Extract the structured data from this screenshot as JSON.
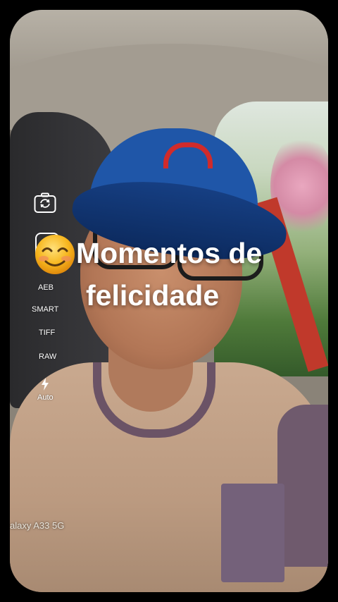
{
  "overlay_text": {
    "line1": "Momentos de",
    "line2": "felicidade"
  },
  "camera_controls": {
    "switch_camera_icon": "camera-switch-icon",
    "modes": [
      "AEB",
      "SMART",
      "TIFF",
      "RAW"
    ],
    "flash": {
      "icon": "lightning-icon",
      "label": "Auto"
    }
  },
  "watermark": {
    "device": "alaxy A33 5G"
  },
  "emoji": "smiling-face-emoji",
  "colors": {
    "text": "#ffffff",
    "cap": "#1f56a8",
    "emoji": "#f7b71f"
  }
}
